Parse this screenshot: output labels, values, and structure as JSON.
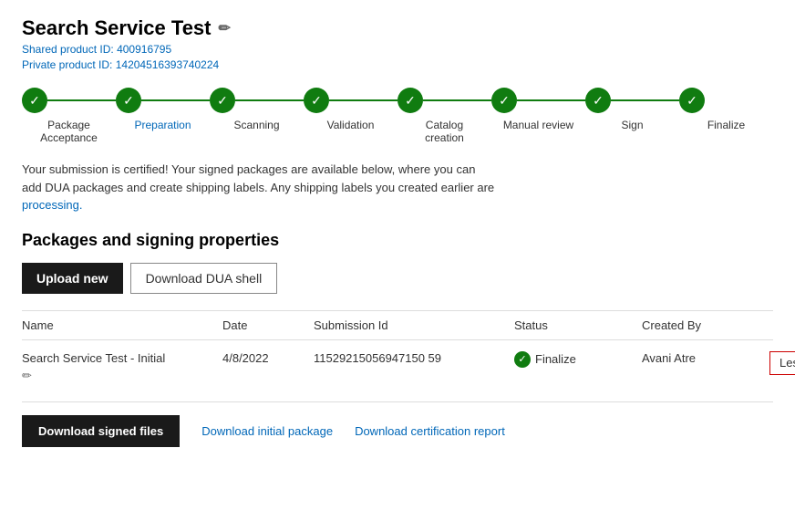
{
  "page": {
    "title": "Search Service Test",
    "edit_icon": "✏",
    "shared_product_label": "Shared product ID:",
    "shared_product_id": "400916795",
    "private_product_label": "Private product ID:",
    "private_product_id": "14204516393740224"
  },
  "steps": [
    {
      "label": "Package\nAcceptance",
      "blue": false,
      "completed": true
    },
    {
      "label": "Preparation",
      "blue": true,
      "completed": true
    },
    {
      "label": "Scanning",
      "blue": false,
      "completed": true
    },
    {
      "label": "Validation",
      "blue": false,
      "completed": true
    },
    {
      "label": "Catalog\ncreation",
      "blue": false,
      "completed": true
    },
    {
      "label": "Manual review",
      "blue": false,
      "completed": true
    },
    {
      "label": "Sign",
      "blue": false,
      "completed": true
    },
    {
      "label": "Finalize",
      "blue": false,
      "completed": true
    }
  ],
  "notification": {
    "text_1": "Your submission is certified! Your signed packages are available below, where you can",
    "text_2": "add DUA packages and create shipping labels. Any shipping labels you created earlier are",
    "text_3": "processing."
  },
  "packages_section": {
    "title": "Packages and signing properties",
    "upload_new_label": "Upload new",
    "download_dua_label": "Download DUA shell"
  },
  "table": {
    "columns": [
      "Name",
      "Date",
      "Submission Id",
      "Status",
      "Created By",
      ""
    ],
    "row": {
      "name": "Search Service Test - Initial",
      "date": "4/8/2022",
      "submission_id": "11529215056947150 59",
      "submission_id_full": "11529215056947150​59",
      "status": "Finalize",
      "created_by": "Avani Atre",
      "less_label": "Less"
    }
  },
  "bottom_buttons": {
    "download_signed": "Download signed files",
    "download_initial": "Download initial package",
    "download_cert": "Download certification report"
  },
  "icons": {
    "check": "✓",
    "edit": "✏",
    "chevron_up": "∧"
  }
}
